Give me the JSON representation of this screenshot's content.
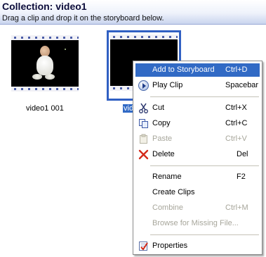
{
  "header": {
    "title": "Collection: video1",
    "subtitle": "Drag a clip and drop it on the storyboard below."
  },
  "clips": [
    {
      "label": "video1 001",
      "selected": false
    },
    {
      "label_visible_fragment": "vid",
      "selected": true
    }
  ],
  "context_menu": {
    "items": [
      {
        "label": "Add to Storyboard",
        "shortcut": "Ctrl+D",
        "highlighted": true,
        "enabled": true,
        "icon": ""
      },
      {
        "label": "Play Clip",
        "shortcut": "Spacebar",
        "enabled": true,
        "icon": "play-icon"
      },
      {
        "label": "Cut",
        "shortcut": "Ctrl+X",
        "enabled": true,
        "icon": "scissors-icon"
      },
      {
        "label": "Copy",
        "shortcut": "Ctrl+C",
        "enabled": true,
        "icon": "copy-icon"
      },
      {
        "label": "Paste",
        "shortcut": "Ctrl+V",
        "enabled": false,
        "icon": "paste-icon"
      },
      {
        "label": "Delete",
        "shortcut": "Del",
        "enabled": true,
        "icon": "delete-x-icon"
      },
      {
        "label": "Rename",
        "shortcut": "F2",
        "enabled": true,
        "icon": ""
      },
      {
        "label": "Create Clips",
        "shortcut": "",
        "enabled": true,
        "icon": ""
      },
      {
        "label": "Combine",
        "shortcut": "Ctrl+M",
        "enabled": false,
        "icon": ""
      },
      {
        "label": "Browse for Missing File...",
        "shortcut": "",
        "enabled": false,
        "icon": ""
      },
      {
        "label": "Properties",
        "shortcut": "",
        "enabled": true,
        "icon": "properties-icon"
      }
    ]
  },
  "colors": {
    "highlight": "#316ac5",
    "selection_border": "#3160c3",
    "disabled_text": "#a7a69b"
  }
}
